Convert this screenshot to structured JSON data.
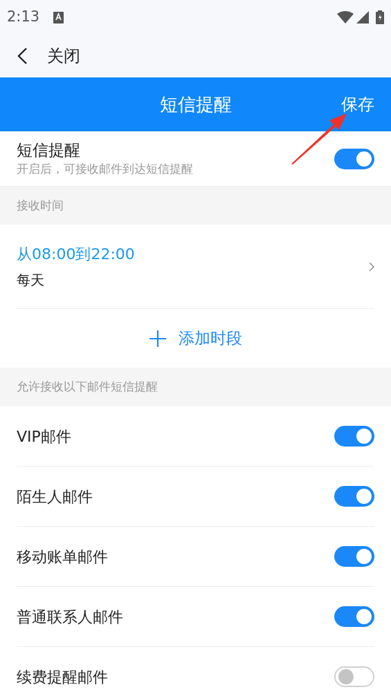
{
  "status_bar": {
    "time": "2:13"
  },
  "nav": {
    "back_label": "关闭"
  },
  "header": {
    "title": "短信提醒",
    "action": "保存"
  },
  "master": {
    "title": "短信提醒",
    "subtitle": "开启后，可接收邮件到达短信提醒",
    "on": true
  },
  "time_section": {
    "heading": "接收时间",
    "range": "从08:00到22:00",
    "repeat": "每天",
    "add_label": "添加时段"
  },
  "filter_section": {
    "heading": "允许接收以下邮件短信提醒",
    "items": [
      {
        "label": "VIP邮件",
        "on": true
      },
      {
        "label": "陌生人邮件",
        "on": true
      },
      {
        "label": "移动账单邮件",
        "on": true
      },
      {
        "label": "普通联系人邮件",
        "on": true
      },
      {
        "label": "续费提醒邮件",
        "on": false
      }
    ]
  }
}
